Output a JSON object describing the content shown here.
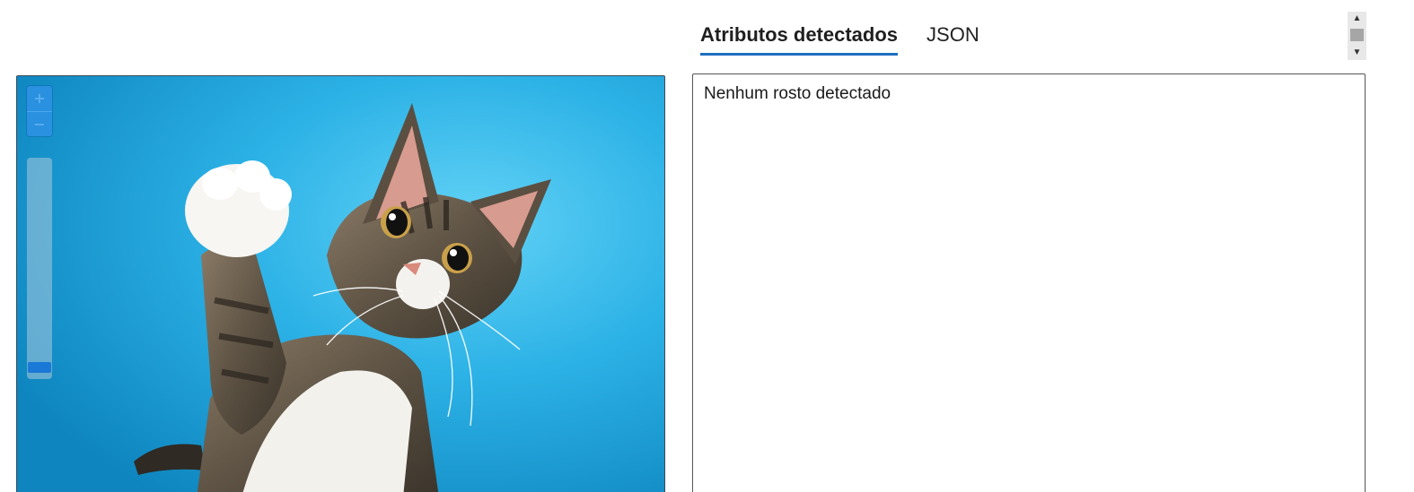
{
  "viewer": {
    "zoom_in_label": "+",
    "zoom_out_label": "−",
    "zoom_level_fraction": 0.03,
    "icons": {
      "zoom_in": "plus-icon",
      "zoom_out": "minus-icon"
    }
  },
  "tabs": [
    {
      "label": "Atributos detectados",
      "active": true
    },
    {
      "label": "JSON",
      "active": false
    }
  ],
  "results": {
    "message": "Nenhum rosto detectado"
  },
  "scrollbar": {
    "up_icon": "scroll-up-arrow-icon",
    "down_icon": "scroll-down-arrow-icon"
  },
  "colors": {
    "accent": "#1f6fbf",
    "photo_background": "#1ea7e0",
    "zoom_control": "#2a90e0"
  }
}
